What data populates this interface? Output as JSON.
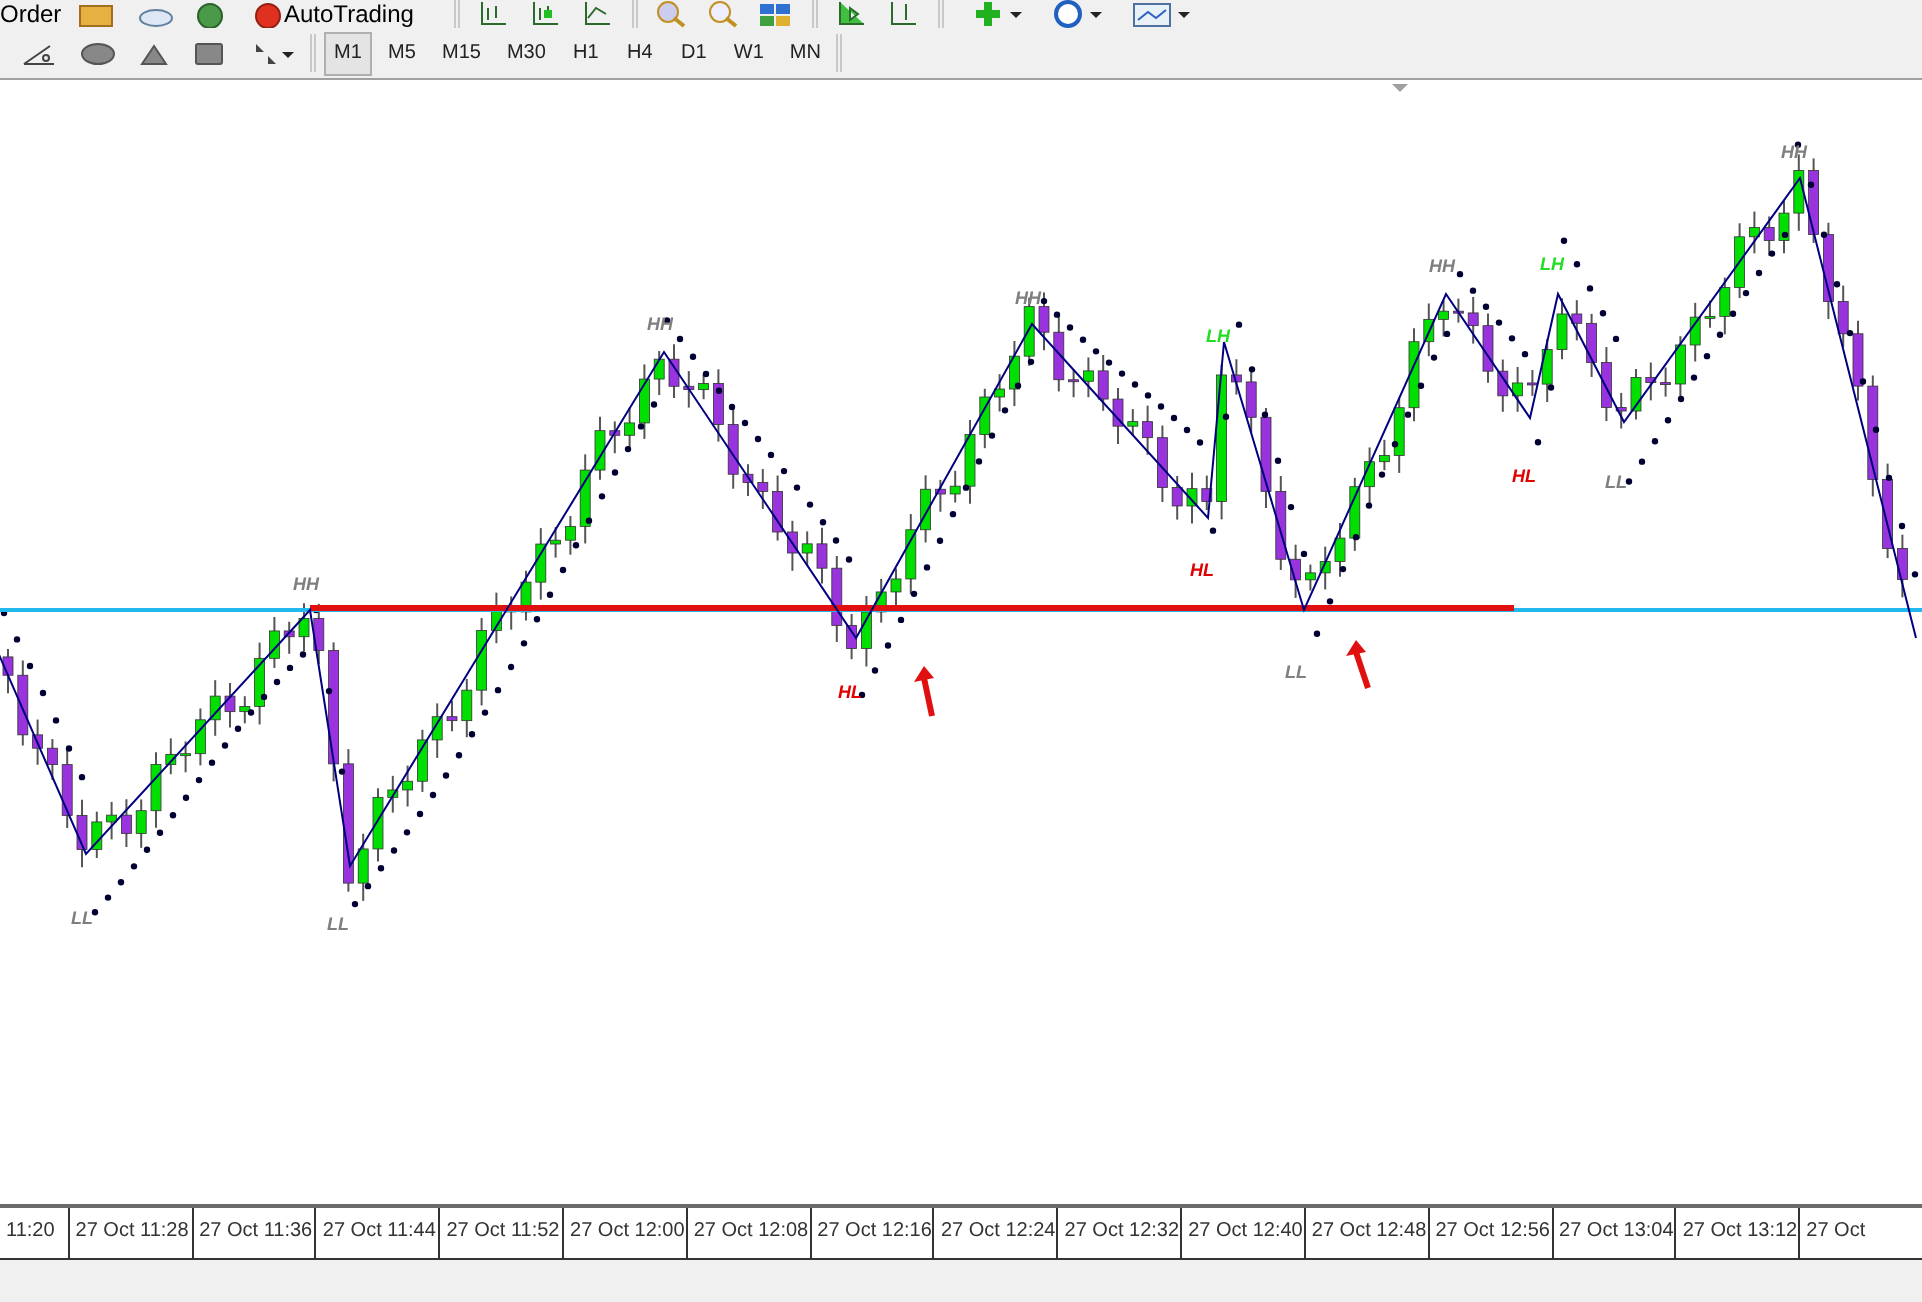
{
  "top_toolbar": {
    "order_label": "Order",
    "autotrading_label": "AutoTrading"
  },
  "timeframes": [
    {
      "label": "M1",
      "selected": true
    },
    {
      "label": "M5",
      "selected": false
    },
    {
      "label": "M15",
      "selected": false
    },
    {
      "label": "M30",
      "selected": false
    },
    {
      "label": "H1",
      "selected": false
    },
    {
      "label": "H4",
      "selected": false
    },
    {
      "label": "D1",
      "selected": false
    },
    {
      "label": "W1",
      "selected": false
    },
    {
      "label": "MN",
      "selected": false
    }
  ],
  "chart": {
    "swing_labels": [
      {
        "text": "HH",
        "color": "#7f7f7f"
      },
      {
        "text": "LL",
        "color": "#7f7f7f"
      },
      {
        "text": "LL",
        "color": "#7f7f7f"
      },
      {
        "text": "HH",
        "color": "#7f7f7f"
      },
      {
        "text": "HL",
        "color": "#e00000"
      },
      {
        "text": "HH",
        "color": "#7f7f7f"
      },
      {
        "text": "LH",
        "color": "#22dd22"
      },
      {
        "text": "HL",
        "color": "#e00000"
      },
      {
        "text": "LL",
        "color": "#7f7f7f"
      },
      {
        "text": "HH",
        "color": "#7f7f7f"
      },
      {
        "text": "LH",
        "color": "#22dd22"
      },
      {
        "text": "HL",
        "color": "#e00000"
      },
      {
        "text": "LL",
        "color": "#7f7f7f"
      },
      {
        "text": "HH",
        "color": "#7f7f7f"
      }
    ],
    "time_axis": [
      "11:20",
      "27 Oct 11:28",
      "27 Oct 11:36",
      "27 Oct 11:44",
      "27 Oct 11:52",
      "27 Oct 12:00",
      "27 Oct 12:08",
      "27 Oct 12:16",
      "27 Oct 12:24",
      "27 Oct 12:32",
      "27 Oct 12:40",
      "27 Oct 12:48",
      "27 Oct 12:56",
      "27 Oct 13:04",
      "27 Oct 13:12",
      "27 Oct"
    ]
  }
}
